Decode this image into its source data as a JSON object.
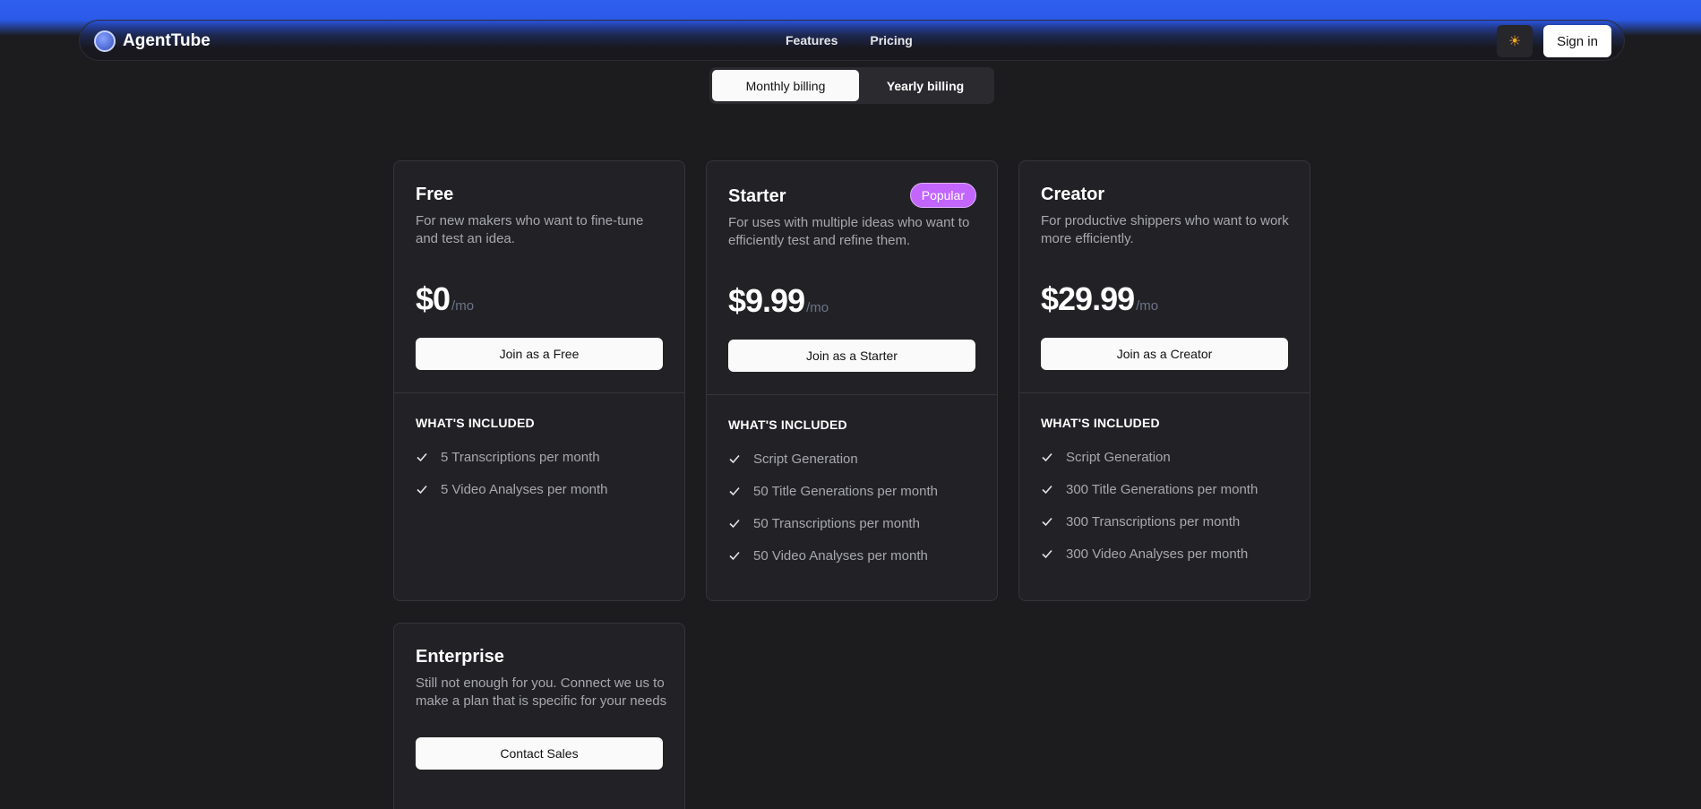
{
  "brand": {
    "name": "AgentTube",
    "logo_icon": "circle-logo-icon"
  },
  "nav": {
    "links": [
      "Features",
      "Pricing"
    ]
  },
  "header": {
    "theme_icon": "sun-icon",
    "theme_glyph": "☀",
    "signin_label": "Sign in"
  },
  "billing": {
    "options": [
      "Monthly billing",
      "Yearly billing"
    ],
    "selected": "Monthly billing"
  },
  "colors": {
    "accent_badge": "#c266ff",
    "header_gradient": "#2f5ff0",
    "background": "#1c1c1f"
  },
  "plans": [
    {
      "name": "Free",
      "description": "For new makers who want to fine-tune and test an idea.",
      "price": "$0",
      "unit": "/mo",
      "button": "Join as a Free",
      "included_title": "WHAT'S INCLUDED",
      "features": [
        "5 Transcriptions per month",
        "5 Video Analyses per month"
      ]
    },
    {
      "name": "Starter",
      "badge": "Popular",
      "description": "For uses with multiple ideas who want to efficiently test and refine them.",
      "price": "$9.99",
      "unit": "/mo",
      "button": "Join as a Starter",
      "included_title": "WHAT'S INCLUDED",
      "features": [
        "Script Generation",
        "50 Title Generations per month",
        "50 Transcriptions per month",
        "50 Video Analyses per month"
      ]
    },
    {
      "name": "Creator",
      "description": "For productive shippers who want to work more efficiently.",
      "price": "$29.99",
      "unit": "/mo",
      "button": "Join as a Creator",
      "included_title": "WHAT'S INCLUDED",
      "features": [
        "Script Generation",
        "300 Title Generations per month",
        "300 Transcriptions per month",
        "300 Video Analyses per month"
      ]
    },
    {
      "name": "Enterprise",
      "description": "Still not enough for you. Connect we us to make a plan that is specific for your needs",
      "button": "Contact Sales"
    }
  ]
}
